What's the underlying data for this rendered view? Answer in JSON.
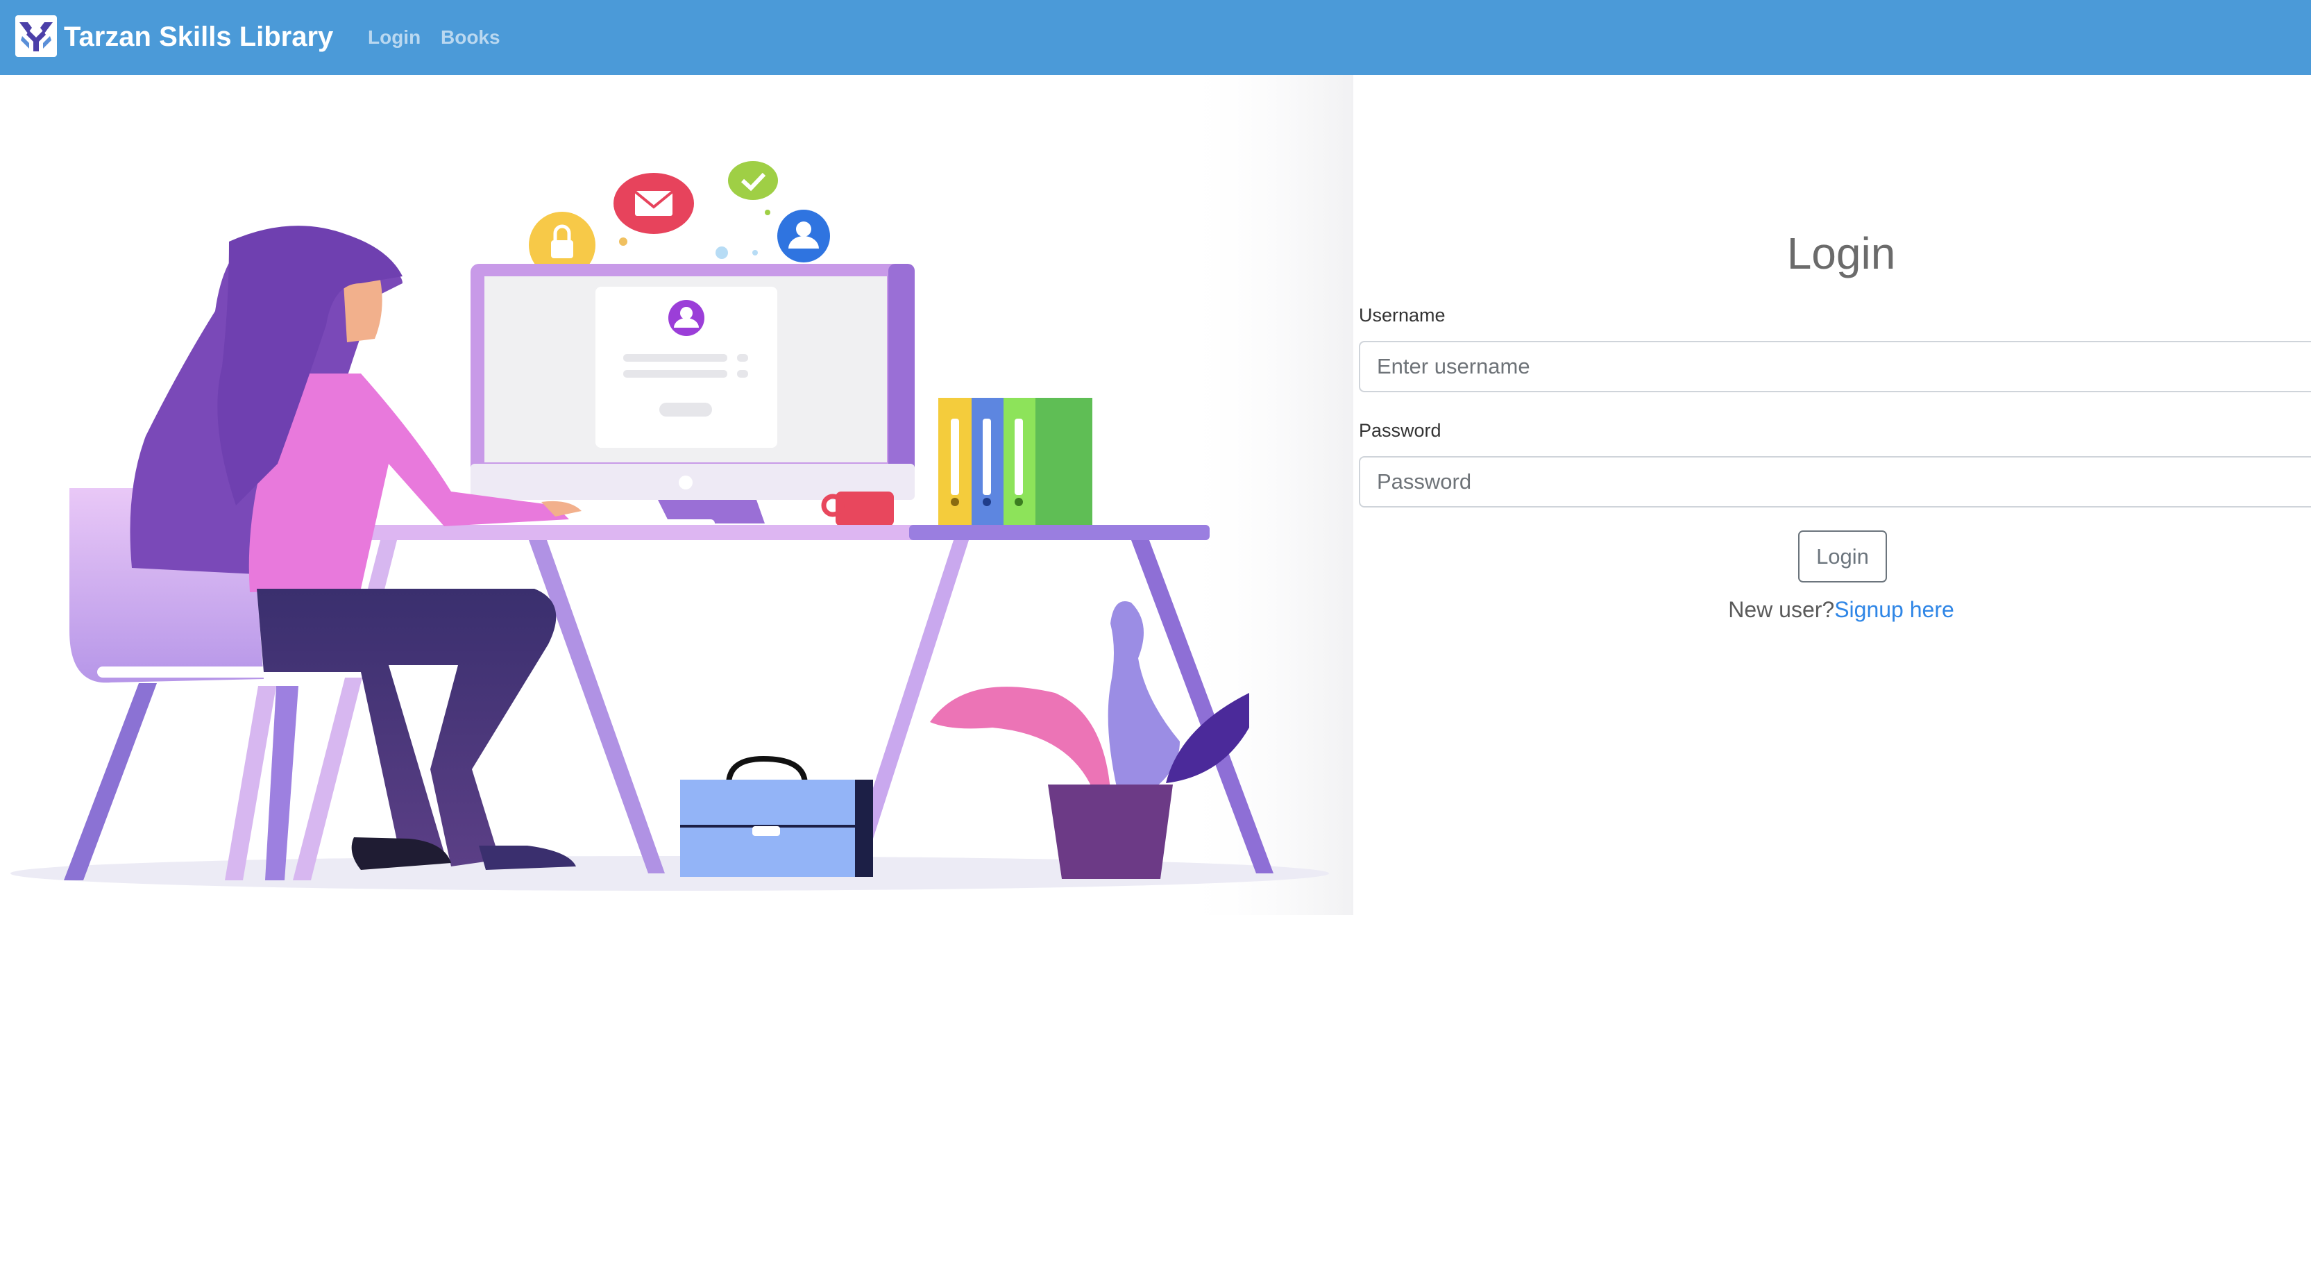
{
  "navbar": {
    "brand": "Tarzan Skills Library",
    "links": [
      {
        "label": "Login"
      },
      {
        "label": "Books"
      }
    ]
  },
  "login_form": {
    "title": "Login",
    "username_label": "Username",
    "username_placeholder": "Enter username",
    "password_label": "Password",
    "password_placeholder": "Password",
    "submit_label": "Login",
    "signup_prompt": "New user?",
    "signup_link": "Signup here"
  },
  "colors": {
    "navbar": "#4b9ad8",
    "link": "#2f86e6",
    "title": "#6b6b6b"
  }
}
